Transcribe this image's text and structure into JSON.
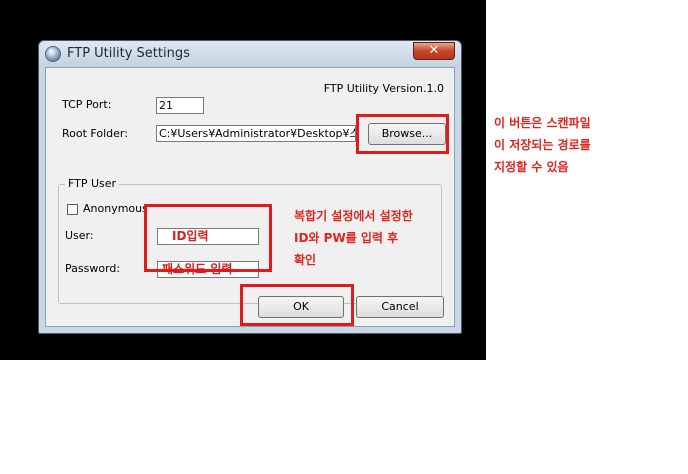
{
  "window": {
    "title": "FTP Utility Settings",
    "close_glyph": "✕",
    "version": "FTP Utility Version.1.0"
  },
  "form": {
    "tcp_port_label": "TCP Port:",
    "tcp_port_value": "21",
    "root_folder_label": "Root Folder:",
    "root_folder_value": "C:¥Users¥Administrator¥Desktop¥스캔",
    "browse_label": "Browse...",
    "ftp_user_group": "FTP User",
    "anonymous_label": "Anonymous",
    "anonymous_checked": false,
    "user_label": "User:",
    "user_value": "ID입력",
    "password_label": "Password:",
    "password_value": "패스워드 입력",
    "ok_label": "OK",
    "cancel_label": "Cancel"
  },
  "annotations": {
    "browse_note": [
      "이 버튼은 스캔파일",
      "이 저장되는 경로를",
      "지정할 수 있음"
    ],
    "credentials_note": [
      "복합기 설정에서 설정한",
      "ID와 PW를 입력 후",
      "확인"
    ]
  },
  "colors": {
    "highlight": "#e01b1b",
    "annotation_text": "#e0241e",
    "dialog_face": "#f0f0f0",
    "window_frame": "#c9d6e3"
  }
}
